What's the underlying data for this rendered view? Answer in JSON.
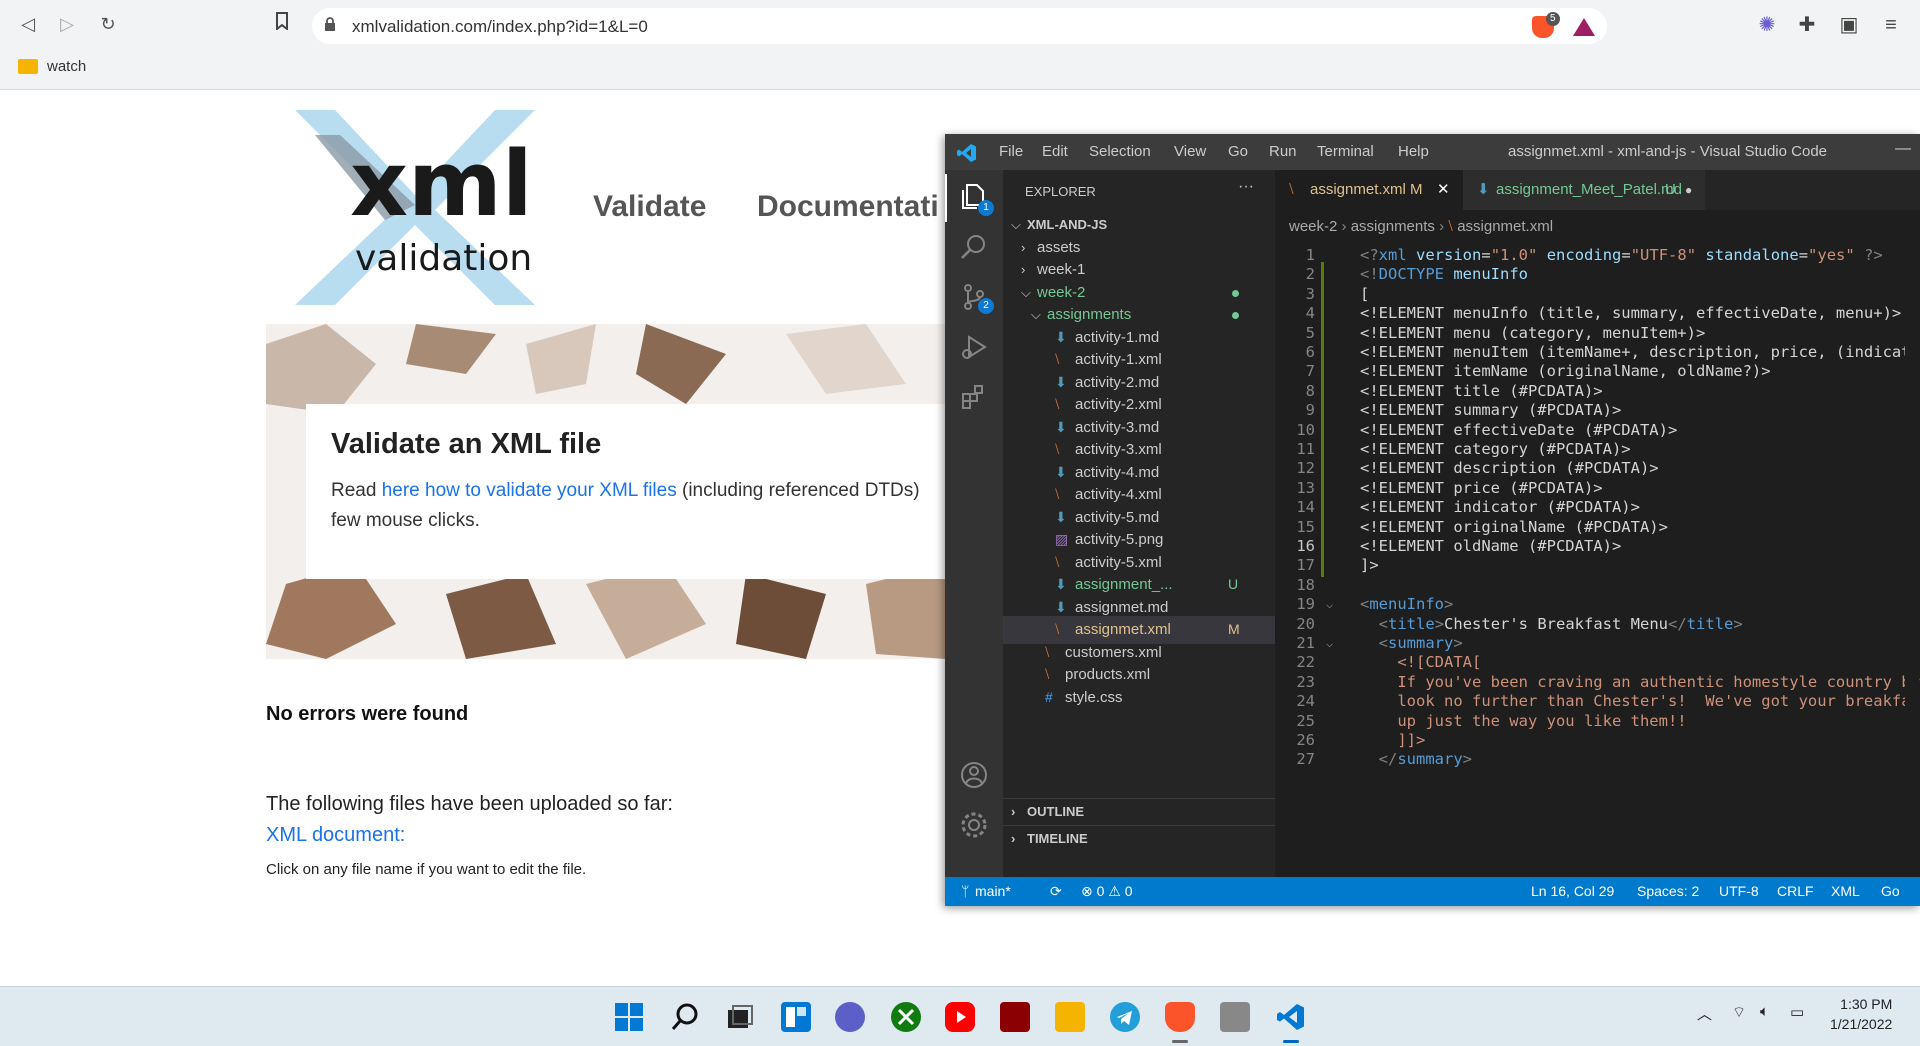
{
  "browser": {
    "url": "xmlvalidation.com/index.php?id=1&L=0",
    "bookmark": "watch",
    "shields_count": "5"
  },
  "page": {
    "logo_text": "xml",
    "logo_sub": "validation",
    "nav": [
      "Validate",
      "Documentati"
    ],
    "hero_title": "Validate an XML file",
    "hero_read": "Read ",
    "hero_link": "here how to validate your XML files",
    "hero_rest": " (including referenced DTDs)",
    "hero_line2": "few mouse clicks.",
    "no_errors": "No errors were found",
    "files_text": "The following files have been uploaded so far:",
    "xml_link": "XML document:",
    "click_hint": "Click on any file name if you want to edit the file."
  },
  "vscode": {
    "menu": [
      "File",
      "Edit",
      "Selection",
      "View",
      "Go",
      "Run",
      "Terminal",
      "Help"
    ],
    "title": "assignmet.xml - xml-and-js - Visual Studio Code",
    "explorer_label": "EXPLORER",
    "more": "···",
    "badges": {
      "explorer": "1",
      "scm": "2"
    },
    "tree": [
      {
        "label": "XML-AND-JS",
        "indent": 0,
        "type": "root",
        "chev": "⌵",
        "bold": true
      },
      {
        "label": "assets",
        "indent": 1,
        "type": "folder",
        "chev": "›"
      },
      {
        "label": "week-1",
        "indent": 1,
        "type": "folder",
        "chev": "›"
      },
      {
        "label": "week-2",
        "indent": 1,
        "type": "folder-open",
        "chev": "⌵",
        "dot": true,
        "color": "#73c991"
      },
      {
        "label": "assignments",
        "indent": 2,
        "type": "folder-open",
        "chev": "⌵",
        "dot": true,
        "color": "#73c991"
      },
      {
        "label": "activity-1.md",
        "indent": 3,
        "type": "md"
      },
      {
        "label": "activity-1.xml",
        "indent": 3,
        "type": "xml"
      },
      {
        "label": "activity-2.md",
        "indent": 3,
        "type": "md"
      },
      {
        "label": "activity-2.xml",
        "indent": 3,
        "type": "xml"
      },
      {
        "label": "activity-3.md",
        "indent": 3,
        "type": "md"
      },
      {
        "label": "activity-3.xml",
        "indent": 3,
        "type": "xml"
      },
      {
        "label": "activity-4.md",
        "indent": 3,
        "type": "md"
      },
      {
        "label": "activity-4.xml",
        "indent": 3,
        "type": "xml"
      },
      {
        "label": "activity-5.md",
        "indent": 3,
        "type": "md"
      },
      {
        "label": "activity-5.png",
        "indent": 3,
        "type": "png"
      },
      {
        "label": "activity-5.xml",
        "indent": 3,
        "type": "xml"
      },
      {
        "label": "assignment_...",
        "indent": 3,
        "type": "md",
        "status": "U",
        "color": "#73c991"
      },
      {
        "label": "assignmet.md",
        "indent": 3,
        "type": "md"
      },
      {
        "label": "assignmet.xml",
        "indent": 3,
        "type": "xml",
        "status": "M",
        "color": "#e2c08d",
        "selected": true
      },
      {
        "label": "customers.xml",
        "indent": 2,
        "type": "xml"
      },
      {
        "label": "products.xml",
        "indent": 2,
        "type": "xml"
      },
      {
        "label": "style.css",
        "indent": 2,
        "type": "css"
      }
    ],
    "sections": [
      "OUTLINE",
      "TIMELINE"
    ],
    "tabs": [
      {
        "label": "assignmet.xml",
        "status": "M",
        "close": "✕",
        "active": true
      },
      {
        "label": "assignment_Meet_Patel.md",
        "status": "U",
        "close": "●",
        "active": false
      }
    ],
    "breadcrumb": [
      "week-2",
      "assignments",
      "assignmet.xml"
    ],
    "code": [
      [
        [
          "c-pun",
          "<?"
        ],
        [
          "c-tag",
          "xml"
        ],
        [
          "c-txt",
          " "
        ],
        [
          "c-attr",
          "version"
        ],
        [
          "c-txt",
          "="
        ],
        [
          "c-str",
          "\"1.0\""
        ],
        [
          "c-txt",
          " "
        ],
        [
          "c-attr",
          "encoding"
        ],
        [
          "c-txt",
          "="
        ],
        [
          "c-str",
          "\"UTF-8\""
        ],
        [
          "c-txt",
          " "
        ],
        [
          "c-attr",
          "standalone"
        ],
        [
          "c-txt",
          "="
        ],
        [
          "c-str",
          "\"yes\""
        ],
        [
          "c-txt",
          " "
        ],
        [
          "c-pun",
          "?>"
        ]
      ],
      [
        [
          "c-pun",
          "<!"
        ],
        [
          "c-tag",
          "DOCTYPE"
        ],
        [
          "c-txt",
          " "
        ],
        [
          "c-attr",
          "menuInfo"
        ]
      ],
      [
        [
          "c-txt",
          "["
        ]
      ],
      [
        [
          "c-txt",
          "<!ELEMENT menuInfo (title, summary, effectiveDate, menu+)>"
        ]
      ],
      [
        [
          "c-txt",
          "<!ELEMENT menu (category, menuItem+)>"
        ]
      ],
      [
        [
          "c-txt",
          "<!ELEMENT menuItem (itemName+, description, price, (indicator?)+"
        ]
      ],
      [
        [
          "c-txt",
          "<!ELEMENT itemName (originalName, oldName?)>"
        ]
      ],
      [
        [
          "c-txt",
          "<!ELEMENT title (#PCDATA)>"
        ]
      ],
      [
        [
          "c-txt",
          "<!ELEMENT summary (#PCDATA)>"
        ]
      ],
      [
        [
          "c-txt",
          "<!ELEMENT effectiveDate (#PCDATA)>"
        ]
      ],
      [
        [
          "c-txt",
          "<!ELEMENT category (#PCDATA)>"
        ]
      ],
      [
        [
          "c-txt",
          "<!ELEMENT description (#PCDATA)>"
        ]
      ],
      [
        [
          "c-txt",
          "<!ELEMENT price (#PCDATA)>"
        ]
      ],
      [
        [
          "c-txt",
          "<!ELEMENT indicator (#PCDATA)>"
        ]
      ],
      [
        [
          "c-txt",
          "<!ELEMENT originalName (#PCDATA)>"
        ]
      ],
      [
        [
          "c-txt",
          "<!ELEMENT oldName (#PCDATA)>"
        ]
      ],
      [
        [
          "c-txt",
          "]>"
        ]
      ],
      [
        [
          "c-txt",
          ""
        ]
      ],
      [
        [
          "c-pun",
          "<"
        ],
        [
          "c-tag",
          "menuInfo"
        ],
        [
          "c-pun",
          ">"
        ]
      ],
      [
        [
          "c-txt",
          "  "
        ],
        [
          "c-pun",
          "<"
        ],
        [
          "c-tag",
          "title"
        ],
        [
          "c-pun",
          ">"
        ],
        [
          "c-txt",
          "Chester's Breakfast Menu"
        ],
        [
          "c-pun",
          "</"
        ],
        [
          "c-tag",
          "title"
        ],
        [
          "c-pun",
          ">"
        ]
      ],
      [
        [
          "c-txt",
          "  "
        ],
        [
          "c-pun",
          "<"
        ],
        [
          "c-tag",
          "summary"
        ],
        [
          "c-pun",
          ">"
        ]
      ],
      [
        [
          "c-cdata",
          "    <![CDATA["
        ]
      ],
      [
        [
          "c-cdata",
          "    If you've been craving an authentic homestyle country breakf"
        ]
      ],
      [
        [
          "c-cdata",
          "    look no further than Chester's!  We've got your breakfast fa"
        ]
      ],
      [
        [
          "c-cdata",
          "    up just the way you like them!!"
        ]
      ],
      [
        [
          "c-cdata",
          "    ]]>"
        ]
      ],
      [
        [
          "c-txt",
          "  "
        ],
        [
          "c-pun",
          "</"
        ],
        [
          "c-tag",
          "summary"
        ],
        [
          "c-pun",
          ">"
        ]
      ]
    ],
    "current_line": 16,
    "fold_lines": [
      19,
      21
    ],
    "status": {
      "branch": "main*",
      "sync": "⟳",
      "problems": "⊗ 0 ⚠ 0",
      "position": "Ln 16, Col 29",
      "spaces": "Spaces: 2",
      "encoding": "UTF-8",
      "eol": "CRLF",
      "language": "XML",
      "golive": "Go"
    }
  },
  "taskbar": {
    "time": "1:30 PM",
    "date": "1/21/2022"
  }
}
